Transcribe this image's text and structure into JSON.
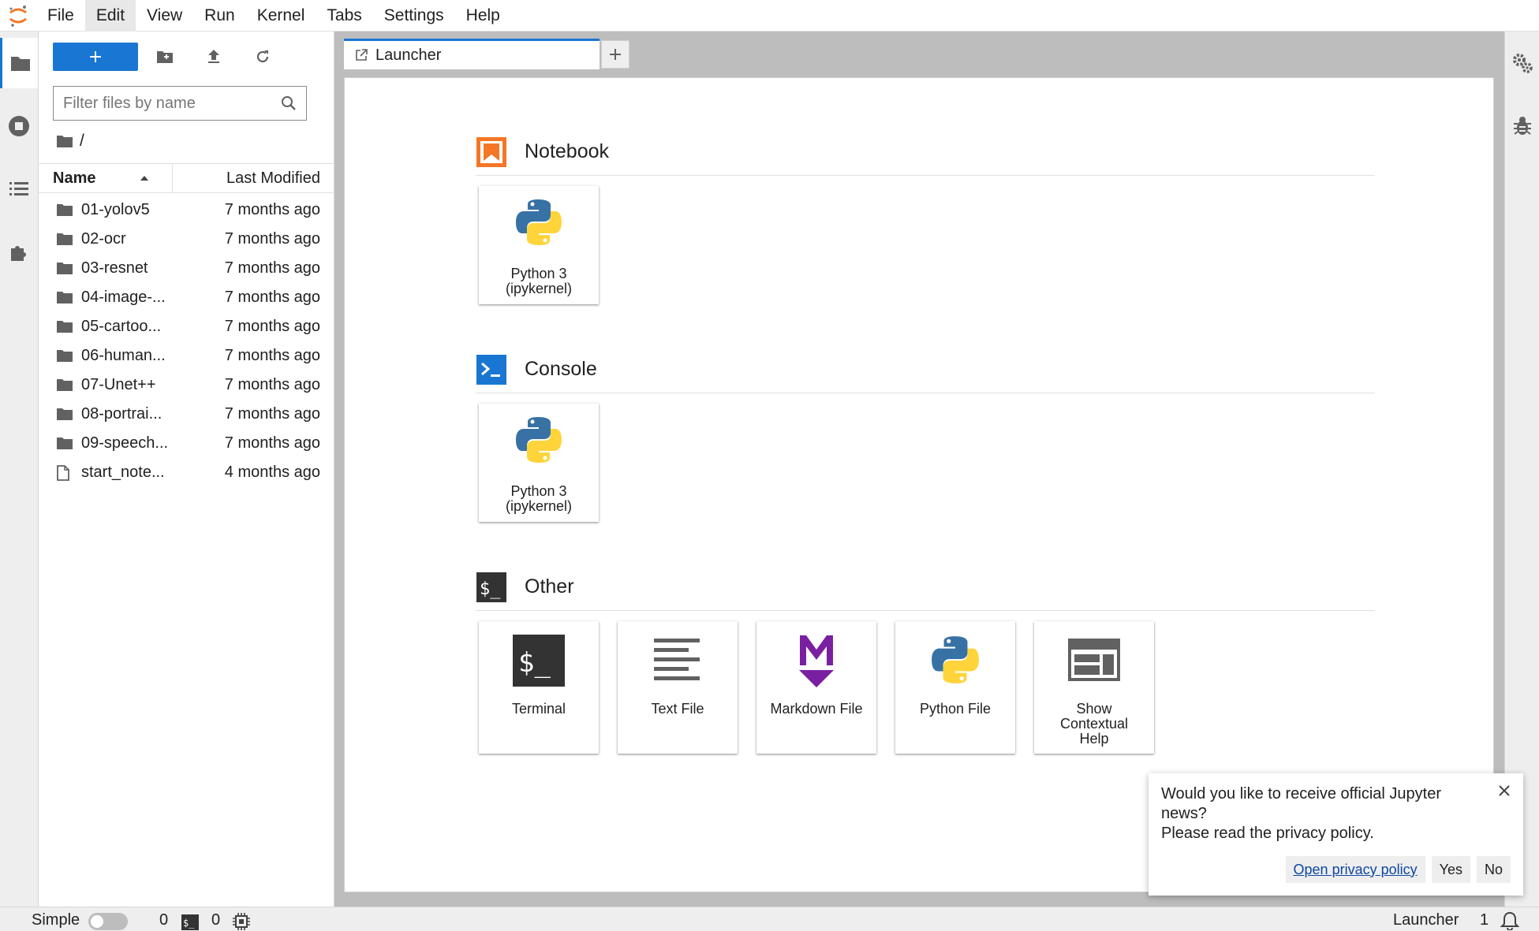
{
  "menubar": {
    "items": [
      "File",
      "Edit",
      "View",
      "Run",
      "Kernel",
      "Tabs",
      "Settings",
      "Help"
    ],
    "active": "Edit"
  },
  "filebrowser": {
    "filter_placeholder": "Filter files by name",
    "breadcrumb": "/",
    "col_name": "Name",
    "col_modified": "Last Modified",
    "files": [
      {
        "name": "01-yolov5",
        "modified": "7 months ago",
        "type": "folder"
      },
      {
        "name": "02-ocr",
        "modified": "7 months ago",
        "type": "folder"
      },
      {
        "name": "03-resnet",
        "modified": "7 months ago",
        "type": "folder"
      },
      {
        "name": "04-image-...",
        "modified": "7 months ago",
        "type": "folder"
      },
      {
        "name": "05-cartoo...",
        "modified": "7 months ago",
        "type": "folder"
      },
      {
        "name": "06-human...",
        "modified": "7 months ago",
        "type": "folder"
      },
      {
        "name": "07-Unet++",
        "modified": "7 months ago",
        "type": "folder"
      },
      {
        "name": "08-portrai...",
        "modified": "7 months ago",
        "type": "folder"
      },
      {
        "name": "09-speech...",
        "modified": "7 months ago",
        "type": "folder"
      },
      {
        "name": "start_note...",
        "modified": "4 months ago",
        "type": "file"
      }
    ]
  },
  "tabs": {
    "launcher_label": "Launcher"
  },
  "launcher": {
    "notebook": {
      "title": "Notebook",
      "cards": [
        {
          "line1": "Python 3",
          "line2": "(ipykernel)"
        }
      ]
    },
    "console": {
      "title": "Console",
      "cards": [
        {
          "line1": "Python 3",
          "line2": "(ipykernel)"
        }
      ]
    },
    "other": {
      "title": "Other",
      "cards": [
        {
          "line1": "Terminal"
        },
        {
          "line1": "Text File"
        },
        {
          "line1": "Markdown File"
        },
        {
          "line1": "Python File"
        },
        {
          "line1": "Show",
          "line2": "Contextual",
          "line3": "Help"
        }
      ]
    }
  },
  "statusbar": {
    "mode_label": "Simple",
    "terminals_count": "0",
    "kernels_count": "0",
    "current_tab": "Launcher",
    "notification_count": "1"
  },
  "toast": {
    "line1": "Would you like to receive official Jupyter news?",
    "line2": "Please read the privacy policy.",
    "privacy_link": "Open privacy policy",
    "yes": "Yes",
    "no": "No"
  },
  "colors": {
    "accent": "#1976d2",
    "notebook_orange": "#f37726",
    "markdown_purple": "#7b1fa2"
  }
}
